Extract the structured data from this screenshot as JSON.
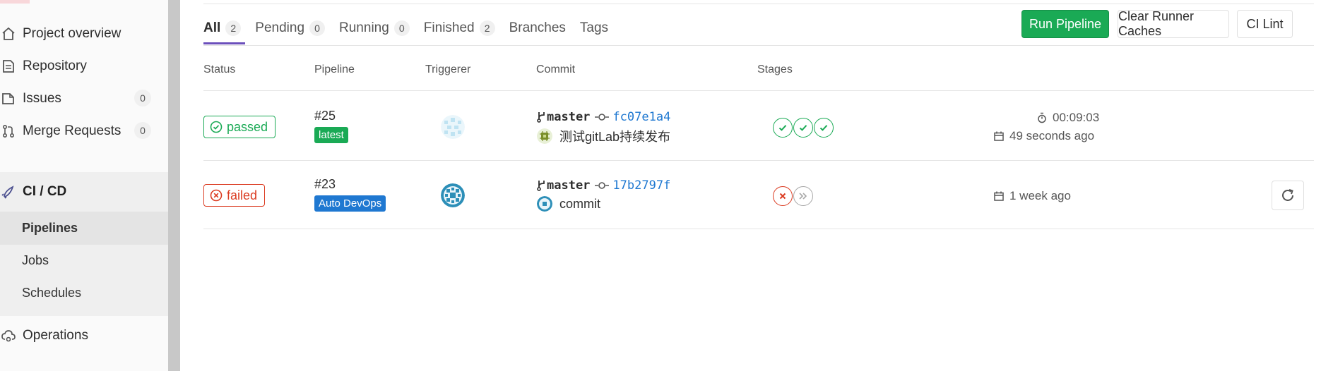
{
  "sidebar": {
    "items": [
      {
        "label": "Project overview",
        "icon": "home-icon"
      },
      {
        "label": "Repository",
        "icon": "document-icon"
      },
      {
        "label": "Issues",
        "icon": "issues-icon",
        "count": "0"
      },
      {
        "label": "Merge Requests",
        "icon": "merge-request-icon",
        "count": "0"
      },
      {
        "label": "CI / CD",
        "icon": "rocket-icon"
      },
      {
        "label": "Operations",
        "icon": "cloud-gear-icon"
      }
    ],
    "sub_items": [
      "Pipelines",
      "Jobs",
      "Schedules"
    ]
  },
  "tabs": [
    {
      "label": "All",
      "count": "2"
    },
    {
      "label": "Pending",
      "count": "0"
    },
    {
      "label": "Running",
      "count": "0"
    },
    {
      "label": "Finished",
      "count": "2"
    },
    {
      "label": "Branches"
    },
    {
      "label": "Tags"
    }
  ],
  "buttons": {
    "run_pipeline": "Run Pipeline",
    "clear_caches": "Clear Runner Caches",
    "ci_lint": "CI Lint"
  },
  "table": {
    "headers": [
      "Status",
      "Pipeline",
      "Triggerer",
      "Commit",
      "Stages"
    ],
    "rows": [
      {
        "status": "passed",
        "pipeline_id": "#25",
        "tag": "latest",
        "branch": "master",
        "sha": "fc07e1a4",
        "message": "测试gitLab持续发布",
        "stages": [
          "success",
          "success",
          "success"
        ],
        "duration": "00:09:03",
        "finished": "49 seconds ago"
      },
      {
        "status": "failed",
        "pipeline_id": "#23",
        "tag": "Auto DevOps",
        "branch": "master",
        "sha": "17b2797f",
        "message": "commit",
        "stages": [
          "failed",
          "skipped"
        ],
        "finished": "1 week ago"
      }
    ]
  },
  "colors": {
    "success": "#1aaa55",
    "failed": "#db3b21",
    "link": "#1f78d1",
    "active_tab": "#6b4fbb"
  }
}
